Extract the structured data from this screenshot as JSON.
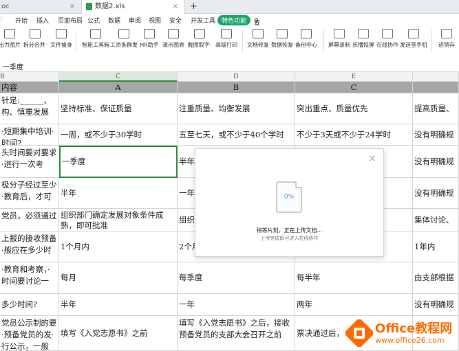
{
  "tabs": {
    "prev_tab": "oc",
    "active_tab": "数据2.xls",
    "add_tab": "+"
  },
  "menu": {
    "items": [
      "开始",
      "插入",
      "页面布局",
      "公式",
      "数据",
      "审阅",
      "视图",
      "安全",
      "开发工具"
    ],
    "special": "特色功能",
    "search": "查找"
  },
  "toolbar": {
    "items": [
      "出为图片",
      "拆分合并·",
      "文件瘦身",
      "智能工具箱",
      "工资条群发",
      "HR助手",
      "演示图表",
      "截图取字·",
      "高级打印",
      "文档修复",
      "数据恢复",
      "备份中心",
      "屏幕录制",
      "乐播投屏",
      "在线协作",
      "发送至手机",
      "进销存"
    ]
  },
  "formula": {
    "cell_ref": "B",
    "value": "一季度"
  },
  "columns": {
    "col_b": "B",
    "col_c": "C",
    "col_d": "D",
    "col_e": "E"
  },
  "table": {
    "header": [
      "内容",
      "A",
      "B",
      "C",
      ""
    ],
    "rows": [
      [
        "针是:______、构、慎重发展",
        "坚持标准、保证质量",
        "注重质量、均衡发展",
        "突出重点、质量优先",
        "提高质量、"
      ],
      [
        "·短期集中培训·时间?",
        "一周，或不少于30学时",
        "五至七天，或不少于40个学时",
        "不少于3天或不少于24学时",
        "没有明确规"
      ],
      [
        "头时间要对要求·进行一次考",
        "一季度",
        "半年",
        "",
        "没有明确规"
      ],
      [
        "极分子经过至少·教育后，才可",
        "半年",
        "一年",
        "",
        "没有明确规"
      ],
      [
        "党员，必须通过",
        "组织部门确定发展对象条件成熟，即可批准",
        "组织",
        "",
        "集体讨论、"
      ],
      [
        "上报的接收预备·般应在多少时",
        "1个月内",
        "2个月",
        "",
        "1年内"
      ],
      [
        "·教育和考察，·时间要讨论一",
        "每月",
        "每季度",
        "每半年",
        "由支部根据"
      ],
      [
        "多少时间?",
        "半年",
        "一年",
        "两年",
        "没有明确规"
      ],
      [
        "党员公示制的要·预备党员的发·行公示，一般",
        "填写《入党志愿书》之前",
        "填写《入党志愿书》之后，接收预备党员的支部大会召开之前",
        "票决通过后，",
        ""
      ]
    ]
  },
  "dialog": {
    "progress": "0%",
    "message": "稍等片刻，正在上传文档...",
    "sub": "上传完成即可进入在线协作",
    "close": "×"
  },
  "logo": {
    "title": "Office教程网",
    "url": "www.office26.com"
  },
  "colors": {
    "accent": "#2e8b43",
    "special_btn": "#1ba56a",
    "logo": "#ff6a00",
    "header_row": "#a6a6a6"
  }
}
